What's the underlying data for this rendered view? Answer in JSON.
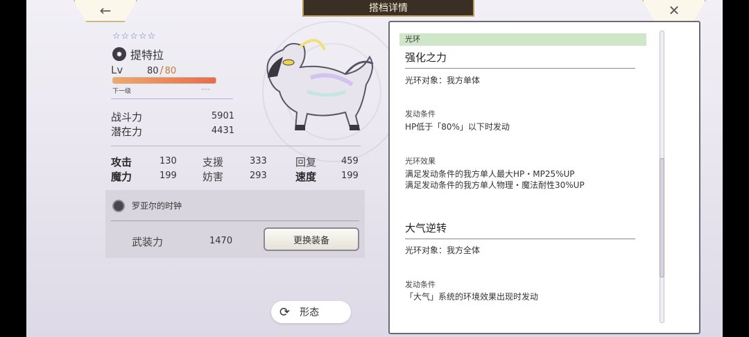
{
  "header": {
    "title": "搭档详情",
    "back_icon": "←",
    "close_icon": "✕"
  },
  "pet": {
    "stars": "☆☆☆☆☆",
    "element_icon": "✸",
    "name": "提特拉",
    "lv_label": "Lv",
    "level": "80",
    "level_sep": "/",
    "level_max": "80",
    "exp_progress": 1.0,
    "next_label": "下一级",
    "next_value": "----"
  },
  "power": [
    {
      "label": "战斗力",
      "value": "5901"
    },
    {
      "label": "潜在力",
      "value": "4431"
    }
  ],
  "stats": [
    {
      "label": "攻击",
      "value": "130"
    },
    {
      "label": "支援",
      "value": "333"
    },
    {
      "label": "回复",
      "value": "459"
    },
    {
      "label": "魔力",
      "value": "199"
    },
    {
      "label": "妨害",
      "value": "293"
    },
    {
      "label": "速度",
      "value": "199"
    }
  ],
  "equipment": {
    "name": "罗亚尔的时钟",
    "armament_label": "武装力",
    "armament_value": "1470",
    "change_button": "更换装备"
  },
  "form_button": {
    "icon": "⟳",
    "label": "形态"
  },
  "aura_panel": {
    "header": "光环",
    "sections": [
      {
        "title": "强化之力",
        "target": "光环对象：我方单体",
        "condition_label": "发动条件",
        "condition": "HP低于「80%」以下时发动",
        "effect_label": "光环效果",
        "effects": [
          "满足发动条件的我方单人最大HP・MP25%UP",
          "满足发动条件的我方单人物理・魔法耐性30%UP"
        ]
      },
      {
        "title": "大气逆转",
        "target": "光环对象：我方全体",
        "condition_label": "发动条件",
        "condition": "「大气」系统的环境效果出现时发动"
      }
    ]
  },
  "colors": {
    "accent_gold": "#b49a5a",
    "panel_header_green": "#cfe6c8",
    "exp_fill": "#e86b4e"
  }
}
